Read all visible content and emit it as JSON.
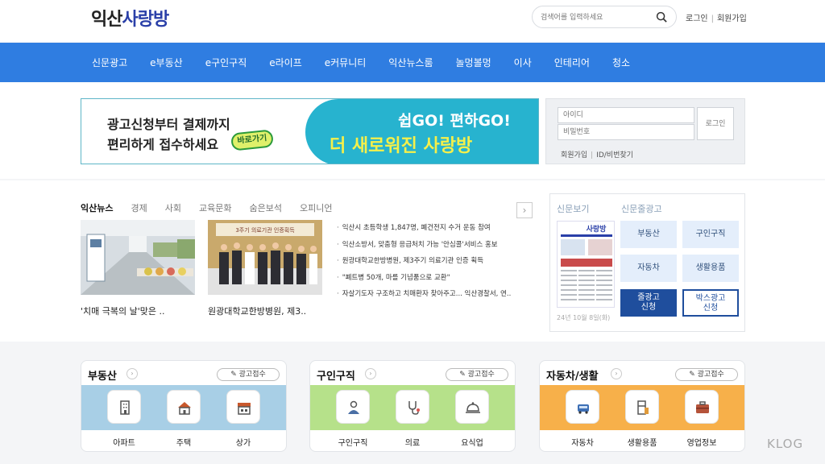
{
  "header": {
    "logo_part1": "익산",
    "logo_part2": "사랑방",
    "search_placeholder": "검색어를 입력하세요",
    "login": "로그인",
    "signup": "회원가입"
  },
  "nav": [
    "신문광고",
    "e부동산",
    "e구인구직",
    "e라이프",
    "e커뮤니티",
    "익산뉴스룸",
    "놀멍볼멍",
    "이사",
    "인테리어",
    "청소"
  ],
  "banner": {
    "left_line1": "광고신청부터 결제까지",
    "left_line2": "편리하게 접수하세요",
    "go_button": "바로가기",
    "right_line1": "쉽GO! 편하GO!",
    "right_line2": "더 새로워진 사랑방"
  },
  "login_box": {
    "id_placeholder": "아이디",
    "pw_placeholder": "비밀번호",
    "login_button": "로그인",
    "signup_link": "회원가입",
    "find_link": "ID/비번찾기"
  },
  "news": {
    "tabs": [
      "익산뉴스",
      "경제",
      "사회",
      "교육문화",
      "숨은보석",
      "오피니언"
    ],
    "captions": [
      "'치매 극복의 날'맞은 ..",
      "원광대학교한방병원, 제3.."
    ],
    "thumb2_sign": "3주기 의료기관 인증획득",
    "headlines": [
      "익산시 초등학생 1,847명, 폐건전지 수거 운동 참여",
      "익산소방서, 맞춤형 응급처치 가능 '안심콜'서비스 홍보",
      "원광대학교한방병원, 제3주기 의료기관 인증 획득",
      "\"폐트병 50개, 마를 기념품으로 교환\"",
      "자살기도자 구조하고 치매환자 찾아주고... 익산경찰서, 연.."
    ]
  },
  "paper": {
    "tab1": "신문보기",
    "tab2": "신문줄광고",
    "masthead": "사랑방",
    "date": "24년 10월 8일(화)",
    "buttons": [
      "부동산",
      "구인구직",
      "자동차",
      "생활용품"
    ],
    "btn_line_ad": [
      "줄광고",
      "신청"
    ],
    "btn_box_ad": [
      "박스광고",
      "신청"
    ]
  },
  "cards": [
    {
      "title": "부동산",
      "ad": "광고접수",
      "items": [
        "아파트",
        "주택",
        "상가"
      ]
    },
    {
      "title": "구인구직",
      "ad": "광고접수",
      "items": [
        "구인구직",
        "의료",
        "요식업"
      ]
    },
    {
      "title": "자동차/생활",
      "ad": "광고접수",
      "items": [
        "자동차",
        "생활용품",
        "영업정보"
      ]
    }
  ],
  "watermark": "KLOG",
  "colors": {
    "nav_blue": "#2f7de1",
    "banner_teal": "#27b3cf",
    "banner_yellow": "#f5f04a",
    "navy_button": "#1f4e9d",
    "strip_realestate": "#a8cfe6",
    "strip_jobs": "#b6e18a",
    "strip_car": "#f7b04a"
  },
  "icons": [
    "search-icon",
    "chevron-right-icon",
    "pencil-icon",
    "building-icon",
    "house-icon",
    "store-icon",
    "person-icon",
    "stethoscope-icon",
    "food-cloche-icon",
    "car-icon",
    "household-icon",
    "briefcase-icon"
  ]
}
